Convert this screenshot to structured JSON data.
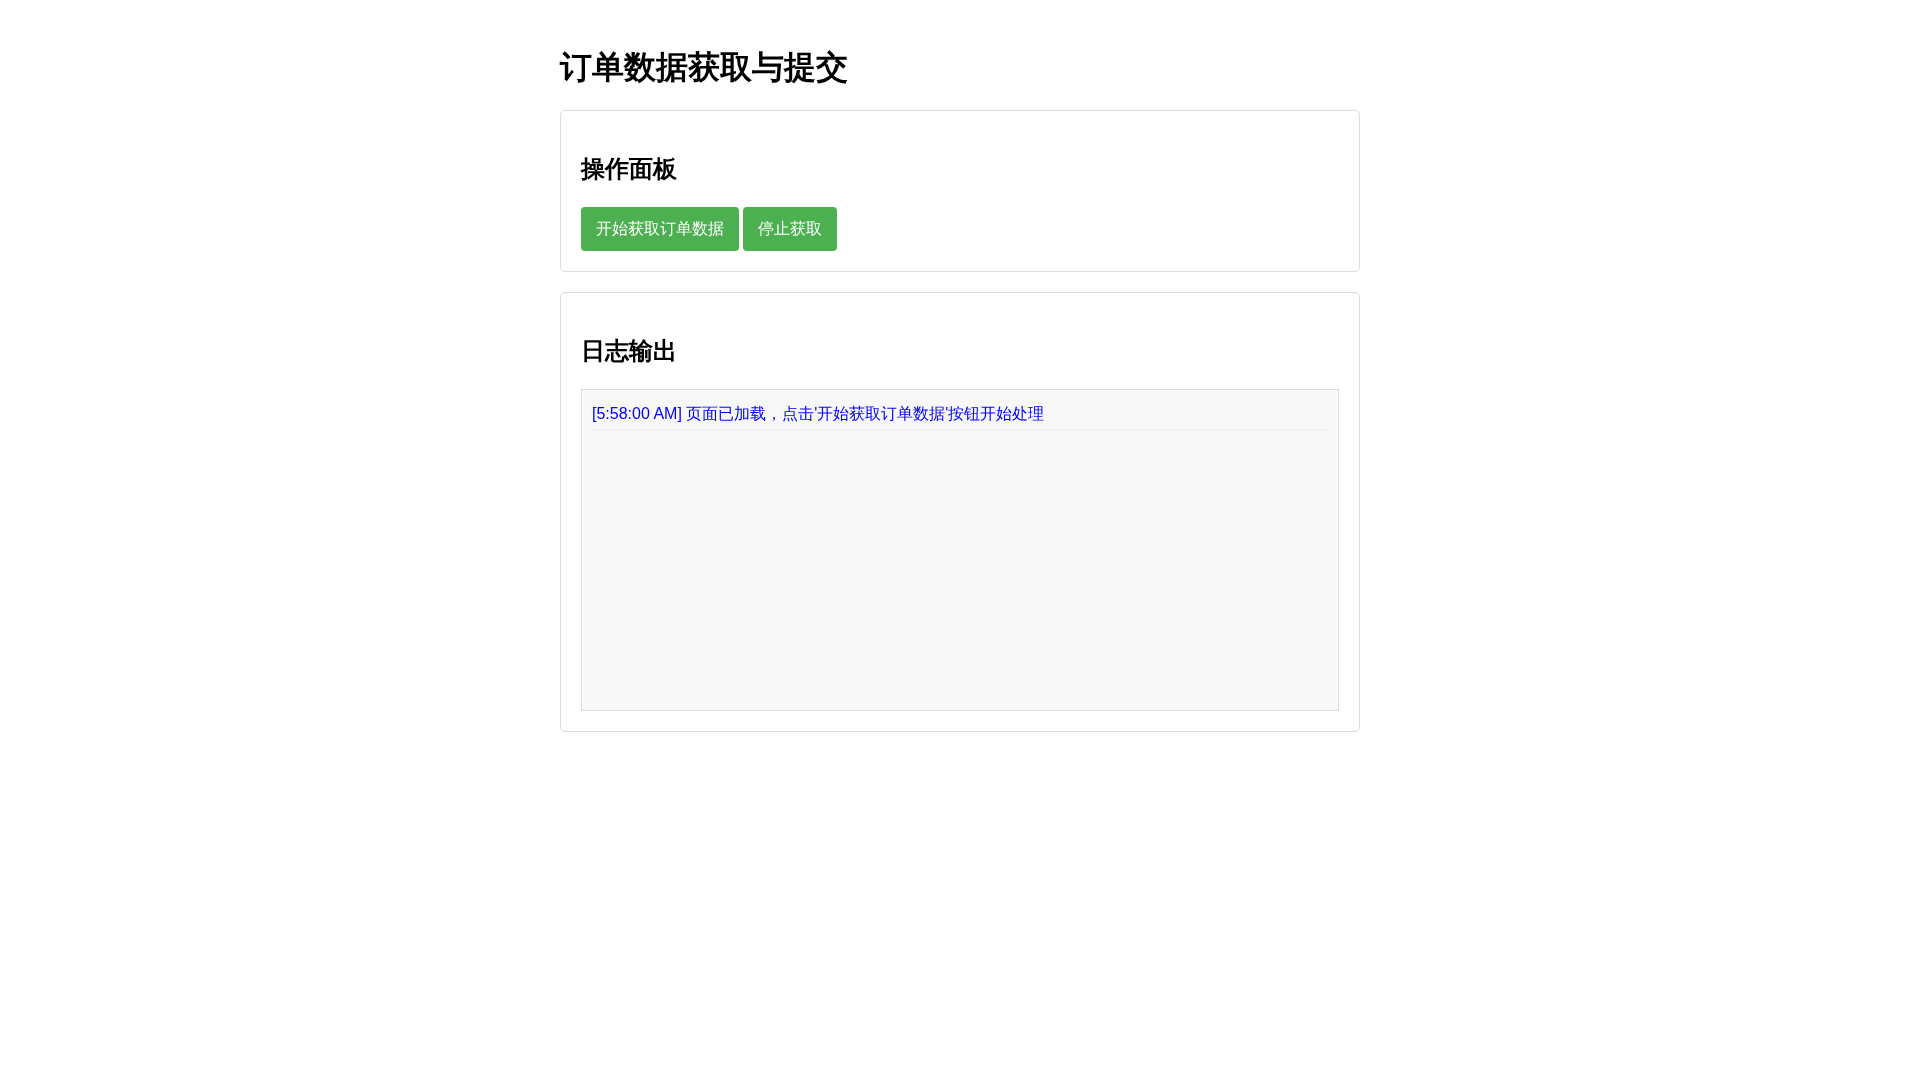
{
  "page": {
    "title": "订单数据获取与提交"
  },
  "control_panel": {
    "heading": "操作面板",
    "buttons": [
      {
        "label": "开始获取订单数据"
      },
      {
        "label": "停止获取"
      }
    ]
  },
  "log_panel": {
    "heading": "日志输出",
    "entries": [
      {
        "kind": "info",
        "text": "[5:58:00 AM] 页面已加载，点击'开始获取订单数据'按钮开始处理"
      }
    ]
  }
}
